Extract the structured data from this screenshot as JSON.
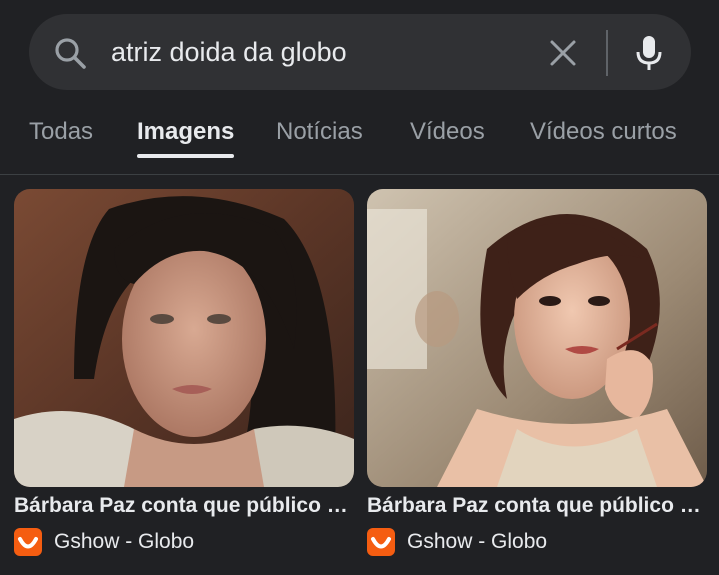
{
  "search": {
    "query": "atriz doida da globo"
  },
  "tabs": [
    {
      "label": "Todas",
      "active": false
    },
    {
      "label": "Imagens",
      "active": true
    },
    {
      "label": "Notícias",
      "active": false
    },
    {
      "label": "Vídeos",
      "active": false
    },
    {
      "label": "Vídeos curtos",
      "active": false
    }
  ],
  "results": [
    {
      "title": "Bárbara Paz conta que público a...",
      "source": "Gshow - Globo",
      "favicon": "gshow-icon"
    },
    {
      "title": "Bárbara Paz conta que público a...",
      "source": "Gshow - Globo",
      "favicon": "gshow-icon"
    }
  ],
  "colors": {
    "background": "#202124",
    "search_bar": "#303134",
    "text_primary": "#e8eaed",
    "text_secondary": "#9aa0a6",
    "favicon_orange": "#f55d11"
  },
  "icons": {
    "search": "search-icon",
    "clear": "close-icon",
    "mic": "microphone-icon"
  }
}
